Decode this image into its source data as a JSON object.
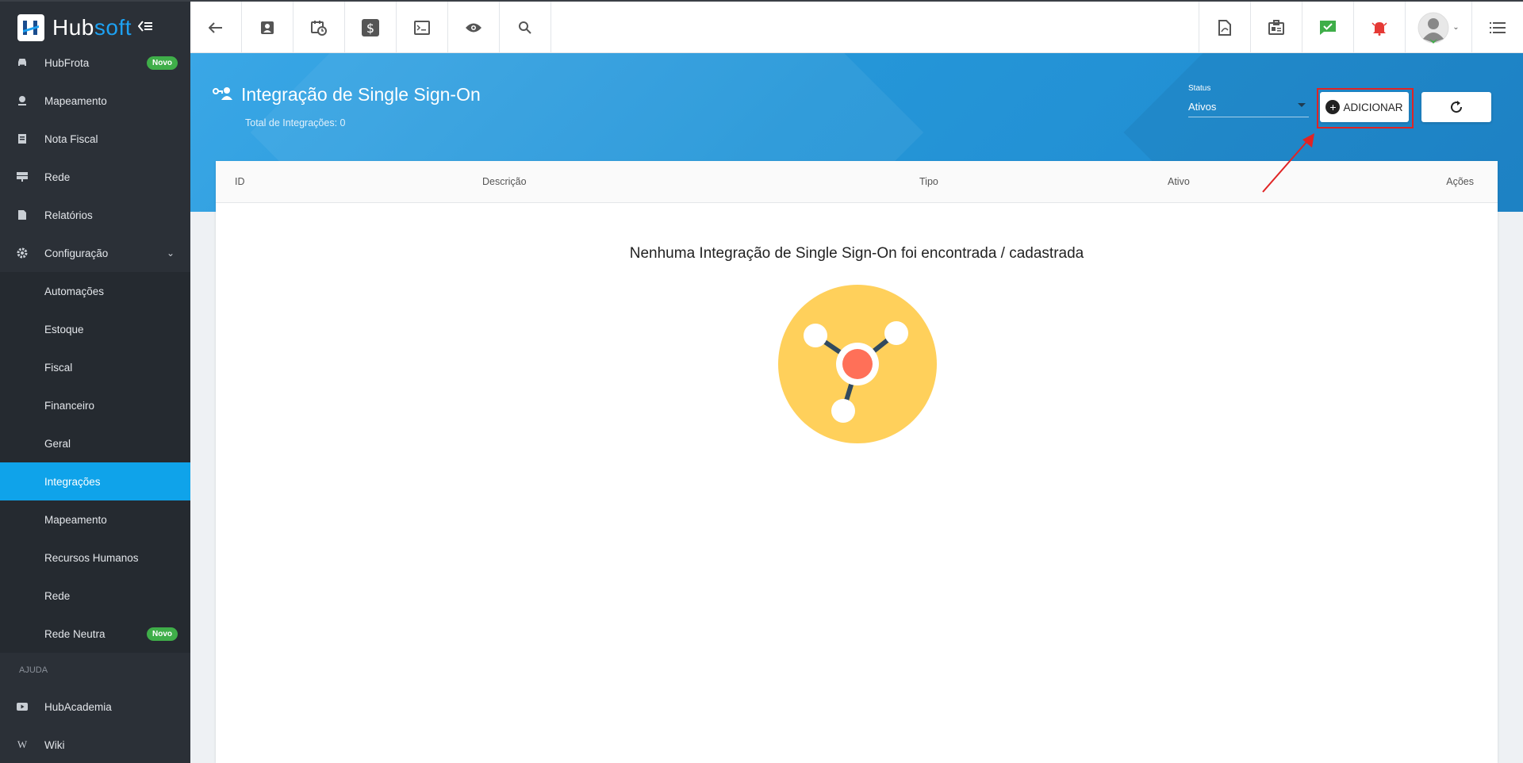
{
  "brand": {
    "name_part1": "Hub",
    "name_part2": "soft"
  },
  "sidebar": {
    "items": [
      {
        "label": "HubFrota",
        "badge": "Novo",
        "icon": "car-icon"
      },
      {
        "label": "Mapeamento",
        "icon": "map-pin-icon"
      },
      {
        "label": "Nota Fiscal",
        "icon": "receipt-icon"
      },
      {
        "label": "Rede",
        "icon": "network-icon"
      },
      {
        "label": "Relatórios",
        "icon": "report-icon"
      },
      {
        "label": "Configuração",
        "icon": "gear-icon"
      }
    ],
    "subitems": [
      {
        "label": "Automações"
      },
      {
        "label": "Estoque"
      },
      {
        "label": "Fiscal"
      },
      {
        "label": "Financeiro"
      },
      {
        "label": "Geral"
      },
      {
        "label": "Integrações",
        "active": true
      },
      {
        "label": "Mapeamento"
      },
      {
        "label": "Recursos Humanos"
      },
      {
        "label": "Rede"
      },
      {
        "label": "Rede Neutra",
        "badge": "Novo"
      }
    ],
    "section_help": "AJUDA",
    "help_items": [
      {
        "label": "HubAcademia",
        "icon": "youtube-icon"
      },
      {
        "label": "Wiki",
        "icon": "wikipedia-icon"
      }
    ]
  },
  "page": {
    "title": "Integração de Single Sign-On",
    "subtitle": "Total de Integrações: 0",
    "status_label": "Status",
    "status_value": "Ativos",
    "add_button": "ADICIONAR"
  },
  "table": {
    "columns": [
      "ID",
      "Descrição",
      "Tipo",
      "Ativo",
      "Ações"
    ],
    "empty_message": "Nenhuma Integração de Single Sign-On foi encontrada / cadastrada"
  },
  "colors": {
    "sidebar_bg": "#2b3037",
    "active_item": "#0fa3ea",
    "header_band": "#2596d8",
    "badge_green": "#3fae49",
    "alert_red": "#e53935",
    "check_green": "#3fae49",
    "illustration_yellow": "#ffd05b",
    "illustration_core": "#ff7058",
    "highlight_red": "#e02424"
  }
}
